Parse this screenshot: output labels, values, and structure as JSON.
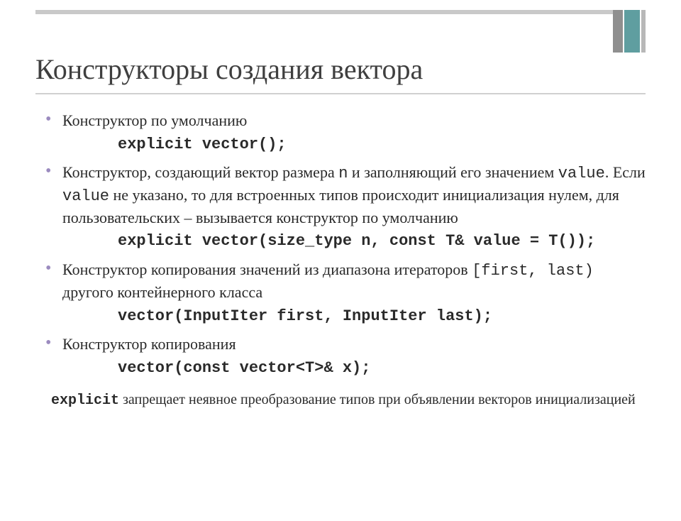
{
  "title": "Конструкторы создания вектора",
  "items": [
    {
      "text": "Конструктор по умолчанию",
      "code": "explicit vector();"
    },
    {
      "pre1": "Конструктор, создающий вектор размера ",
      "c1": "n",
      "mid1": " и заполняющий его значением ",
      "c2": "value",
      "mid2": ". Если ",
      "c3": "value",
      "post": " не указано, то для встроенных типов происходит инициализация нулем, для пользовательских – вызывается конструктор по умолчанию",
      "code": "explicit vector(size_type n, const T& value = T());"
    },
    {
      "pre1": "Конструктор копирования значений из диапазона итераторов ",
      "c1": "[first, last)",
      "post": " другого контейнерного класса",
      "code": "vector(InputIter first, InputIter last);"
    },
    {
      "text": "Конструктор копирования",
      "code": "vector(const vector<T>& x);"
    }
  ],
  "footnote": {
    "kw": "explicit",
    "rest": " запрещает неявное преобразование типов при объявлении векторов инициализацией"
  }
}
